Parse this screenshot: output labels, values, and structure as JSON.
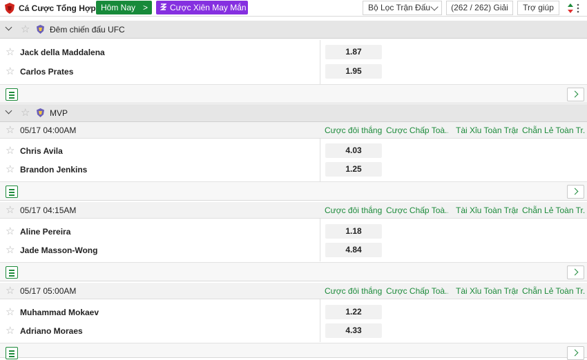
{
  "colors": {
    "accent_green": "#178a3a",
    "parlay_purple": "#8530e0",
    "market_text": "#1c8a3a"
  },
  "topbar": {
    "title": "Cá Cược Tổng Hợp",
    "today_button": "Hôm Nay",
    "today_arrow": ">",
    "parlay_icon": "zigzag-icon",
    "parlay_button": "Cược Xiên May Mắn",
    "filter_label": "Bộ Lọc Trận Đấu",
    "league_count": "(262 / 262) Giải",
    "help_label": "Trợ giúp"
  },
  "leagues": [
    {
      "name": "Đêm chiến đấu UFC"
    },
    {
      "name": "MVP"
    }
  ],
  "markets": [
    "Cược đôi thắng",
    "Cược Chấp Toà...",
    "Tài Xỉu Toàn Trận",
    "Chẵn Lẻ Toàn Tr..."
  ],
  "matches": [
    {
      "time": "",
      "team1": "Jack della Maddalena",
      "team2": "Carlos Prates",
      "odd1": "1.87",
      "odd2": "1.95"
    },
    {
      "time": "05/17 04:00AM",
      "team1": "Chris Avila",
      "team2": "Brandon Jenkins",
      "odd1": "4.03",
      "odd2": "1.25"
    },
    {
      "time": "05/17 04:15AM",
      "team1": "Aline Pereira",
      "team2": "Jade Masson-Wong",
      "odd1": "1.18",
      "odd2": "4.84"
    },
    {
      "time": "05/17 05:00AM",
      "team1": "Muhammad Mokaev",
      "team2": "Adriano Moraes",
      "odd1": "1.22",
      "odd2": "4.33"
    }
  ]
}
